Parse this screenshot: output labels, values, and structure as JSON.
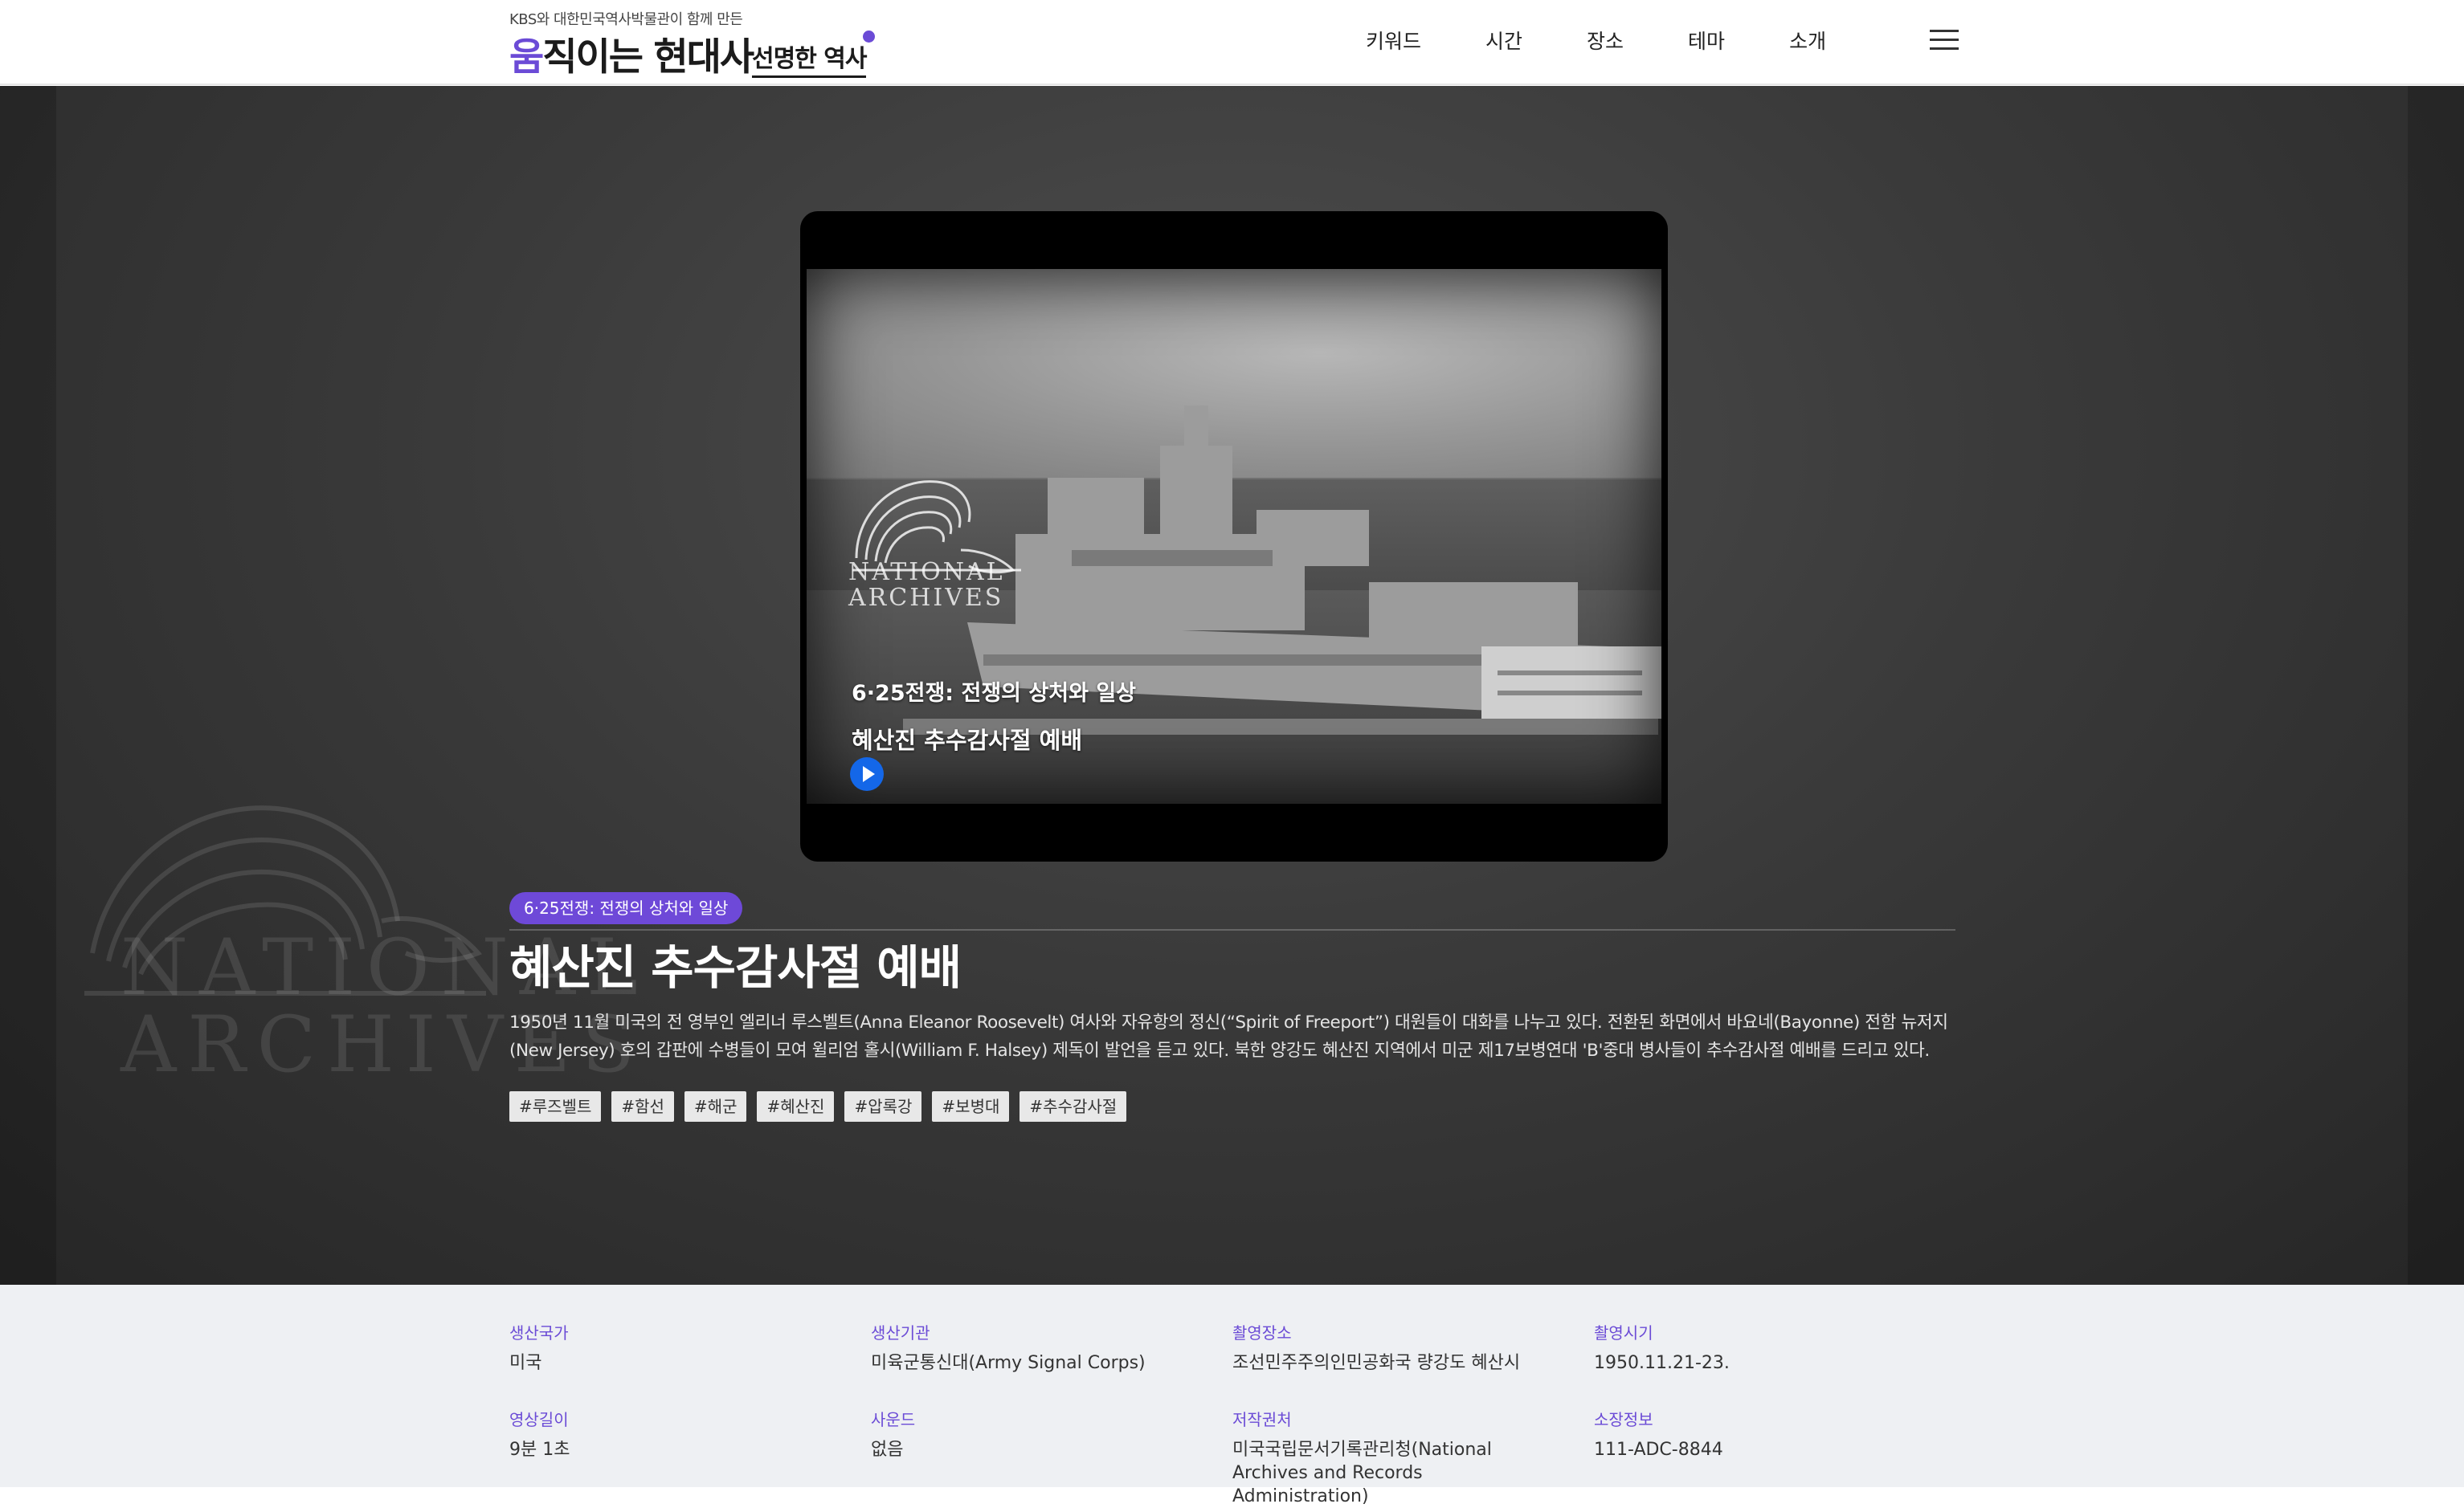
{
  "header": {
    "logo_top": "KBS와 대한민국역사박물관이 함께 만든",
    "logo_accent": "움",
    "logo_main": "직이는 현대사",
    "logo_sub": "선명한 역사",
    "nav": [
      "키워드",
      "시간",
      "장소",
      "테마",
      "소개"
    ],
    "menu_icon": "hamburger-menu-icon"
  },
  "hero": {
    "watermark_line1": "NATIONAL",
    "watermark_line2": "ARCHIVES",
    "video": {
      "watermark_line1": "NATIONAL",
      "watermark_line2": "ARCHIVES",
      "category": "6·25전쟁: 전쟁의 상처와 일상",
      "title": "혜산진 추수감사절 예배",
      "play_icon": "play-icon"
    },
    "category_badge": "6·25전쟁: 전쟁의 상처와 일상",
    "title": "혜산진 추수감사절 예배",
    "description": "1950년 11월 미국의 전 영부인 엘리너 루스벨트(Anna Eleanor Roosevelt) 여사와 자유항의 정신(“Spirit of Freeport”) 대원들이 대화를 나누고 있다. 전환된 화면에서 바요네(Bayonne) 전함 뉴저지(New Jersey) 호의 갑판에 수병들이 모여 윌리엄 홀시(William F. Halsey) 제독이 발언을 듣고 있다. 북한 양강도 혜산진 지역에서 미군 제17보병연대 'B'중대 병사들이 추수감사절 예배를 드리고 있다.",
    "tags": [
      "#루즈벨트",
      "#함선",
      "#해군",
      "#혜산진",
      "#압록강",
      "#보병대",
      "#추수감사절"
    ]
  },
  "info": {
    "country_label": "생산국가",
    "country": "미국",
    "producer_label": "생산기관",
    "producer": "미육군통신대(Army Signal Corps)",
    "location_label": "촬영장소",
    "location": "조선민주주의인민공화국 량강도 혜산시",
    "date_label": "촬영시기",
    "date": "1950.11.21-23.",
    "length_label": "영상길이",
    "length": "9분 1초",
    "sound_label": "사운드",
    "sound": "없음",
    "copyright_label": "저작권처",
    "copyright": "미국국립문서기록관리청(National Archives and Records Administration)",
    "holding_label": "소장정보",
    "holding": "111-ADC-8844"
  },
  "colors": {
    "accent": "#6b4bd6",
    "badge": "#6e49d8",
    "play": "#1467e8"
  }
}
